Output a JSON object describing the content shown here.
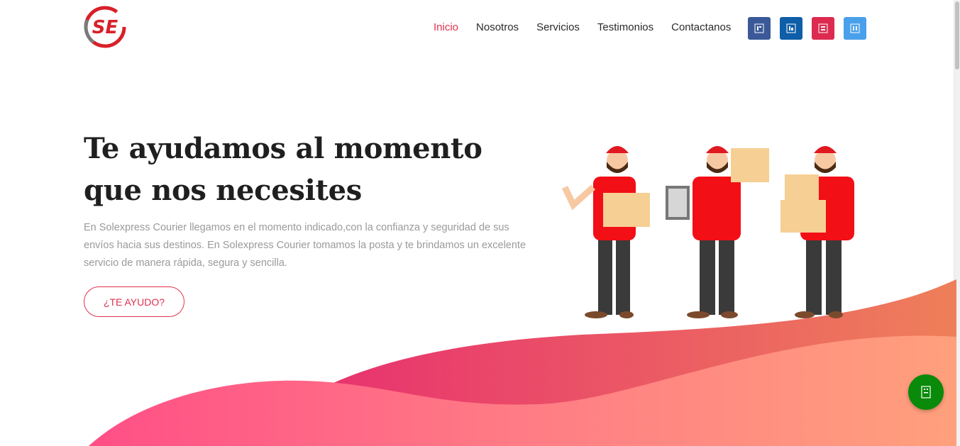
{
  "header": {
    "logo_text": "SE",
    "nav": [
      {
        "label": "Inicio",
        "active": true
      },
      {
        "label": "Nosotros",
        "active": false
      },
      {
        "label": "Servicios",
        "active": false
      },
      {
        "label": "Testimonios",
        "active": false
      },
      {
        "label": "Contactanos",
        "active": false
      }
    ],
    "socials": [
      {
        "icon": "facebook-icon",
        "color": "#3b5998"
      },
      {
        "icon": "linkedin-icon",
        "color": "#0e5ea8"
      },
      {
        "icon": "instagram-icon",
        "color": "#dc2a50"
      },
      {
        "icon": "twitter-icon",
        "color": "#4aa0ea"
      }
    ]
  },
  "hero": {
    "title_line1": "Te ayudamos al momento",
    "title_line2": "que nos necesites",
    "text": "En Solexpress Courier llegamos en el momento indicado,con la confianza y seguridad de sus envíos hacia sus destinos. En Solexpress Courier tomamos la posta y te brindamos un excelente servicio de manera rápida, segura y sencilla.",
    "cta_label": "¿TE AYUDO?"
  },
  "colors": {
    "accent": "#e0314f",
    "wave_start": "#f0407a",
    "wave_end": "#f6a37e",
    "whatsapp": "#0a8a0a"
  },
  "floating": {
    "icon": "whatsapp-icon"
  }
}
